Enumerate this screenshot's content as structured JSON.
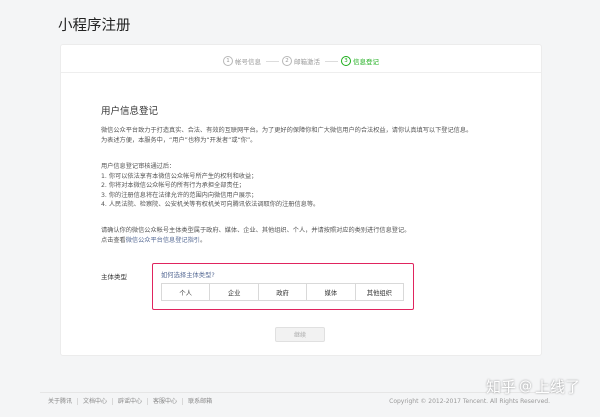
{
  "page_title": "小程序注册",
  "steps": [
    {
      "num": "1",
      "label": "帐号信息"
    },
    {
      "num": "2",
      "label": "邮箱激活"
    },
    {
      "num": "3",
      "label": "信息登记"
    }
  ],
  "section_title": "用户信息登记",
  "intro": {
    "line1": "微信公众平台致力于打造真实、合法、有效的互联网平台。为了更好的保障你和广大微信用户的合法权益，请你认真填写以下登记信息。",
    "line2": "为表述方便，本服务中，“用户”也称为“开发者”或“你”。"
  },
  "review": {
    "heading": "用户信息登记审核通过后：",
    "items": [
      "1. 你可以依法享有本微信公众帐号所产生的权利和收益；",
      "2. 你将对本微信公众帐号的所有行为承担全部责任；",
      "3. 你的注册信息将在法律允许的范围内向微信用户展示；",
      "4. 人民法院、检察院、公安机关等有权机关可向腾讯依法调取你的注册信息等。"
    ]
  },
  "guide": {
    "line1": "请确认你的微信公众帐号主体类型属于政府、媒体、企业、其他组织、个人，并请按照对应的类别进行信息登记。",
    "line2_prefix": "点击查看",
    "line2_link": "微信公众平台信息登记指引",
    "line2_suffix": "。"
  },
  "subject": {
    "label": "主体类型",
    "question": "如何选择主体类型?",
    "options": [
      "个人",
      "企业",
      "政府",
      "媒体",
      "其他组织"
    ]
  },
  "continue_label": "继续",
  "footer": {
    "links": [
      "关于腾讯",
      "文档中心",
      "辟谣中心",
      "客服中心",
      "联系邮箱"
    ],
    "copyright": "Copyright © 2012-2017 Tencent. All Rights Reserved."
  },
  "watermark": {
    "left": "知乎",
    "at": "@",
    "right": "上线了"
  },
  "colors": {
    "accent_green": "#1aad19",
    "link_blue": "#576b95",
    "highlight_red": "#e0245e"
  }
}
